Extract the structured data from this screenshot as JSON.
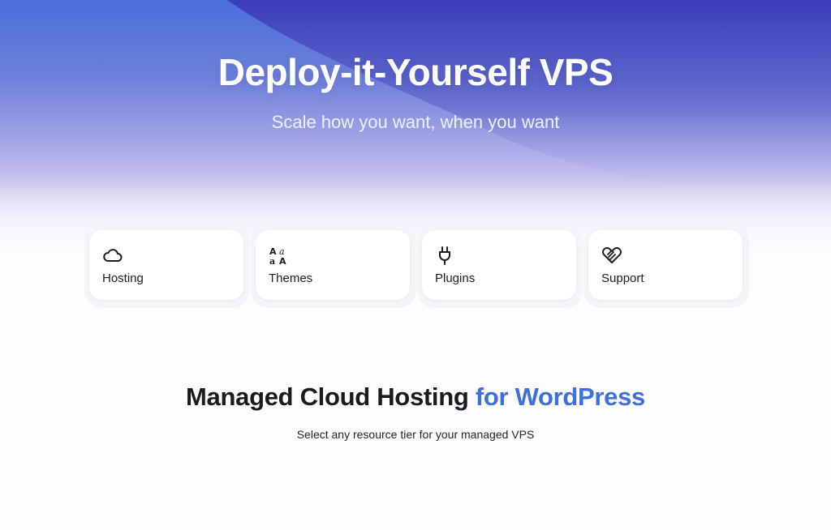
{
  "hero": {
    "title": "Deploy-it-Yourself VPS",
    "subtitle": "Scale how you want, when you want"
  },
  "cards": [
    {
      "label": "Hosting",
      "icon": "cloud-icon"
    },
    {
      "label": "Themes",
      "icon": "typography-icon"
    },
    {
      "label": "Plugins",
      "icon": "plug-icon"
    },
    {
      "label": "Support",
      "icon": "handshake-icon"
    }
  ],
  "section": {
    "title_main": "Managed Cloud Hosting",
    "title_accent": "for WordPress",
    "description": "Select any resource tier for your managed VPS"
  },
  "colors": {
    "accent": "#3f6fdb",
    "hero_top": "#4a6fd9",
    "hero_dark": "#3a3fb5"
  }
}
